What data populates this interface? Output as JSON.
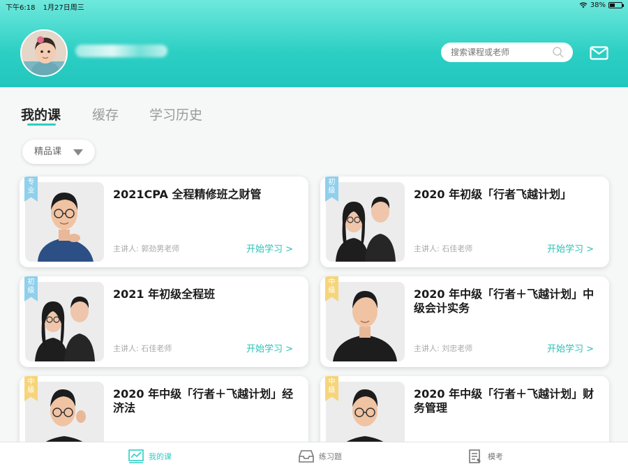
{
  "status_bar": {
    "time": "下午6:18",
    "date": "1月27日周三",
    "battery": "38%"
  },
  "header": {
    "search_placeholder": "搜索课程或老师"
  },
  "tabs": [
    {
      "label": "我的课",
      "active": true
    },
    {
      "label": "缓存",
      "active": false
    },
    {
      "label": "学习历史",
      "active": false
    }
  ],
  "filter": {
    "selected": "精品课"
  },
  "courses": [
    {
      "title": "2021CPA 全程精修班之财管",
      "lecturer": "主讲人: 郭劲男老师",
      "badge": "专业",
      "badge_color": "#8fd0ec",
      "action": "开始学习 >"
    },
    {
      "title": "2020 年初级「行者飞越计划」",
      "lecturer": "主讲人: 石佳老师",
      "badge": "初级",
      "badge_color": "#8fd0ec",
      "action": "开始学习 >"
    },
    {
      "title": "2021 年初级全程班",
      "lecturer": "主讲人: 石佳老师",
      "badge": "初级",
      "badge_color": "#8fd0ec",
      "action": "开始学习 >"
    },
    {
      "title": "2020 年中级「行者＋飞越计划」中级会计实务",
      "lecturer": "主讲人: 刘忠老师",
      "badge": "中级",
      "badge_color": "#f6d57a",
      "action": "开始学习 >"
    },
    {
      "title": "2020 年中级「行者＋飞越计划」经济法",
      "lecturer": "",
      "badge": "中级",
      "badge_color": "#f6d57a",
      "action": ""
    },
    {
      "title": "2020 年中级「行者＋飞越计划」财务管理",
      "lecturer": "",
      "badge": "中级",
      "badge_color": "#f6d57a",
      "action": ""
    }
  ],
  "bottom_nav": [
    {
      "label": "我的课",
      "icon": "chart-icon",
      "active": true
    },
    {
      "label": "练习题",
      "icon": "tray-icon",
      "active": false
    },
    {
      "label": "模考",
      "icon": "document-icon",
      "active": false
    }
  ],
  "colors": {
    "accent": "#2ccfc4",
    "blue_badge": "#8fd0ec",
    "yellow_badge": "#f6d57a"
  }
}
